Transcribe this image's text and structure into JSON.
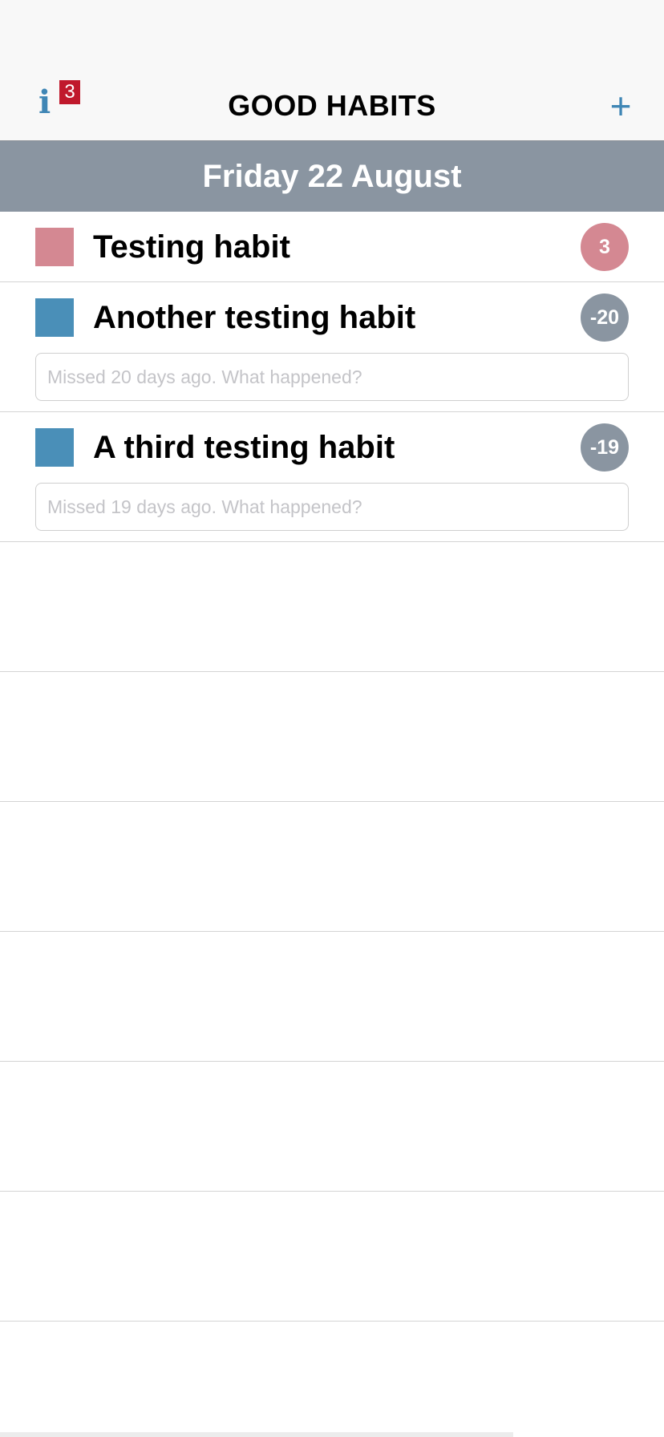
{
  "navbar": {
    "title": "GOOD HABITS",
    "info_badge_count": "3",
    "add_label": "+"
  },
  "date_header": "Friday 22 August",
  "habits": [
    {
      "name": "Testing habit",
      "count": "3",
      "color": "#d48892",
      "count_color": "#d48892",
      "note_placeholder": ""
    },
    {
      "name": "Another testing habit",
      "count": "-20",
      "color": "#4a8fb8",
      "count_color": "#8a95a1",
      "note_placeholder": "Missed 20 days ago. What happened?"
    },
    {
      "name": "A third testing habit",
      "count": "-19",
      "color": "#4a8fb8",
      "count_color": "#8a95a1",
      "note_placeholder": "Missed 19 days ago. What happened?"
    }
  ],
  "colors": {
    "accent": "#3f86b5",
    "badge": "#c0192c",
    "header_bg": "#8a95a1"
  },
  "icons": {
    "info": "info-icon",
    "add": "plus-icon"
  }
}
